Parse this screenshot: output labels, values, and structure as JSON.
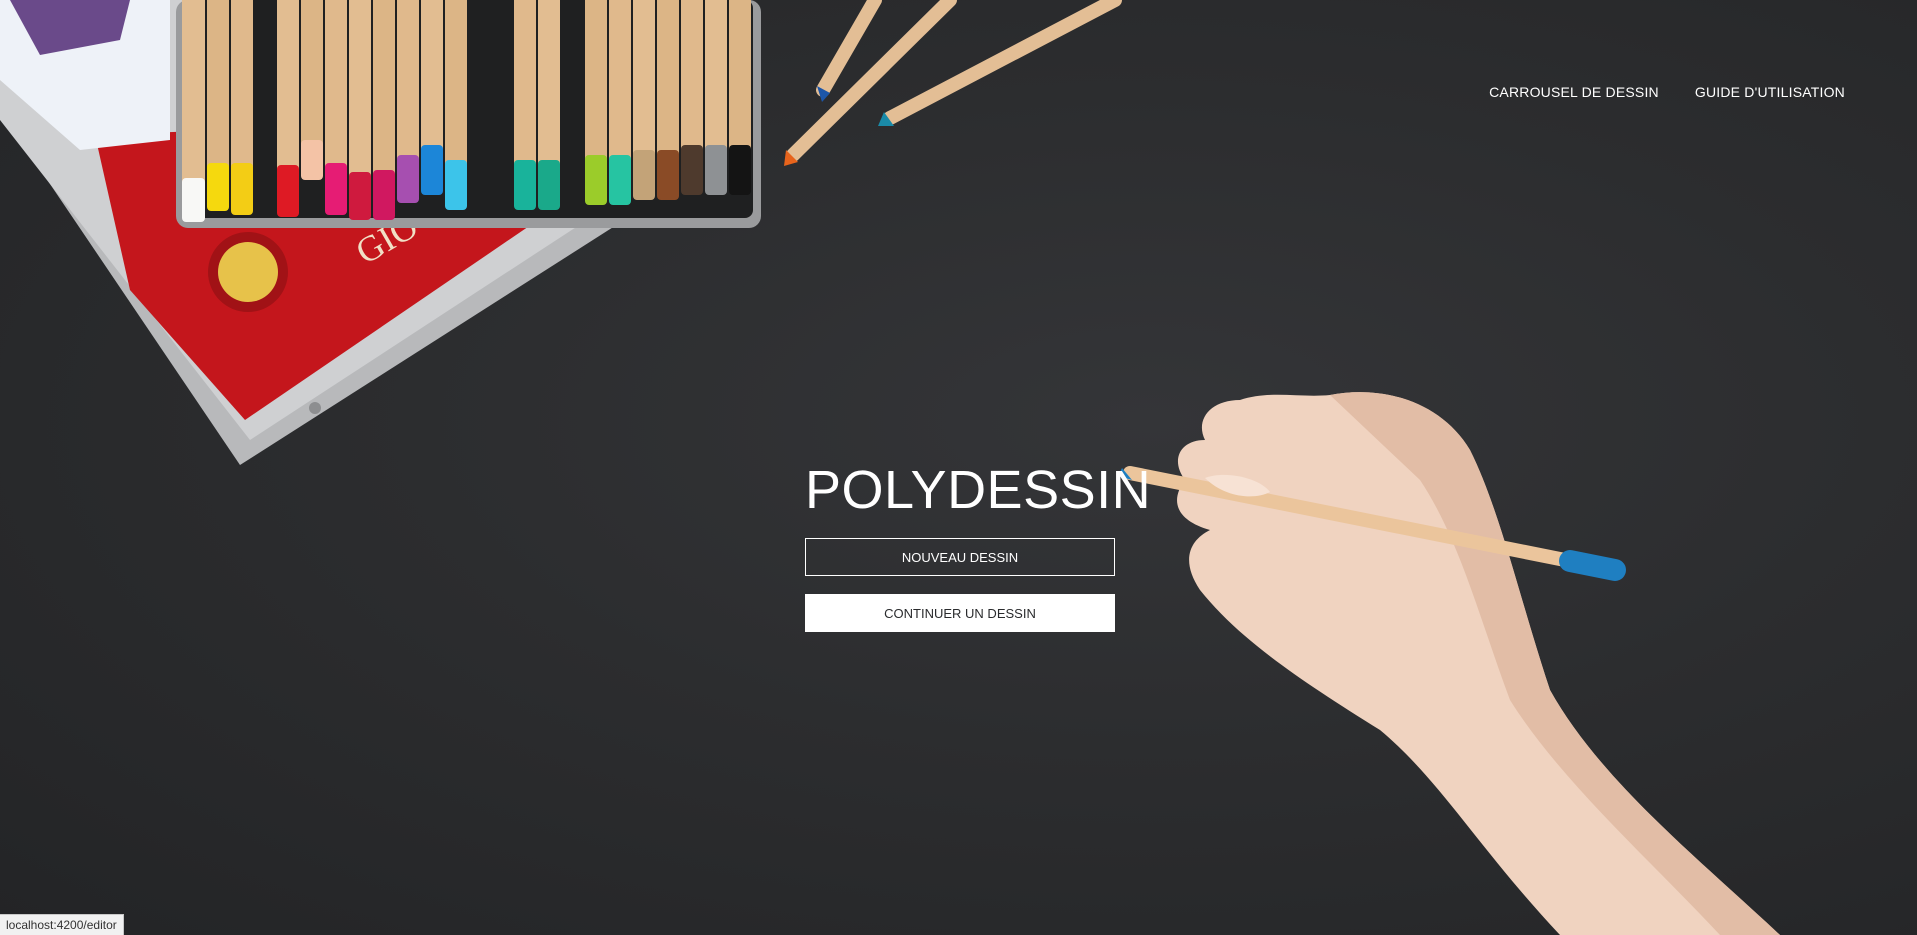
{
  "nav": {
    "items": [
      {
        "label": "CARROUSEL DE DESSIN"
      },
      {
        "label": "GUIDE D'UTILISATION"
      }
    ]
  },
  "hero": {
    "title": "POLYDESSIN",
    "primary_button": "NOUVEAU DESSIN",
    "secondary_button": "CONTINUER UN DESSIN"
  },
  "status_bar": {
    "url": "localhost:4200/editor"
  },
  "colors": {
    "background": "#2c2d2f",
    "text": "#ffffff",
    "pencil_blue": "#1f7fc1",
    "drawing_book_red": "#c4161c"
  }
}
